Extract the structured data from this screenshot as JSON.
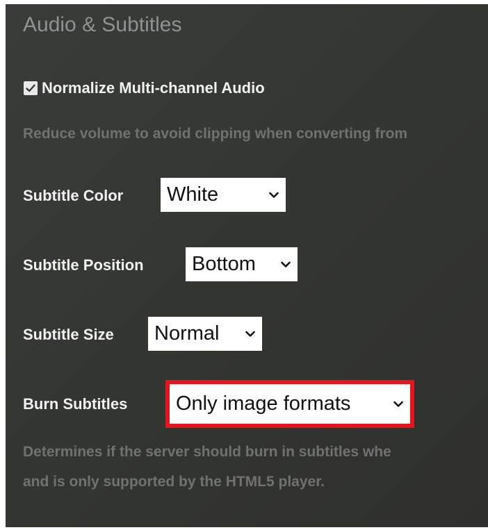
{
  "section": {
    "title": "Audio & Subtitles"
  },
  "normalize": {
    "label": "Normalize Multi-channel Audio",
    "checked": true,
    "help": "Reduce volume to avoid clipping when converting from"
  },
  "subtitle_color": {
    "label": "Subtitle Color",
    "value": "White"
  },
  "subtitle_position": {
    "label": "Subtitle Position",
    "value": "Bottom"
  },
  "subtitle_size": {
    "label": "Subtitle Size",
    "value": "Normal"
  },
  "burn_subtitles": {
    "label": "Burn Subtitles",
    "value": "Only image formats",
    "help_line1": "Determines if the server should burn in subtitles whe",
    "help_line2": "and is only supported by the HTML5 player.",
    "highlight_color": "#e8141b"
  },
  "icons": {
    "checkbox": "check-icon",
    "dropdown": "chevron-down-icon"
  }
}
